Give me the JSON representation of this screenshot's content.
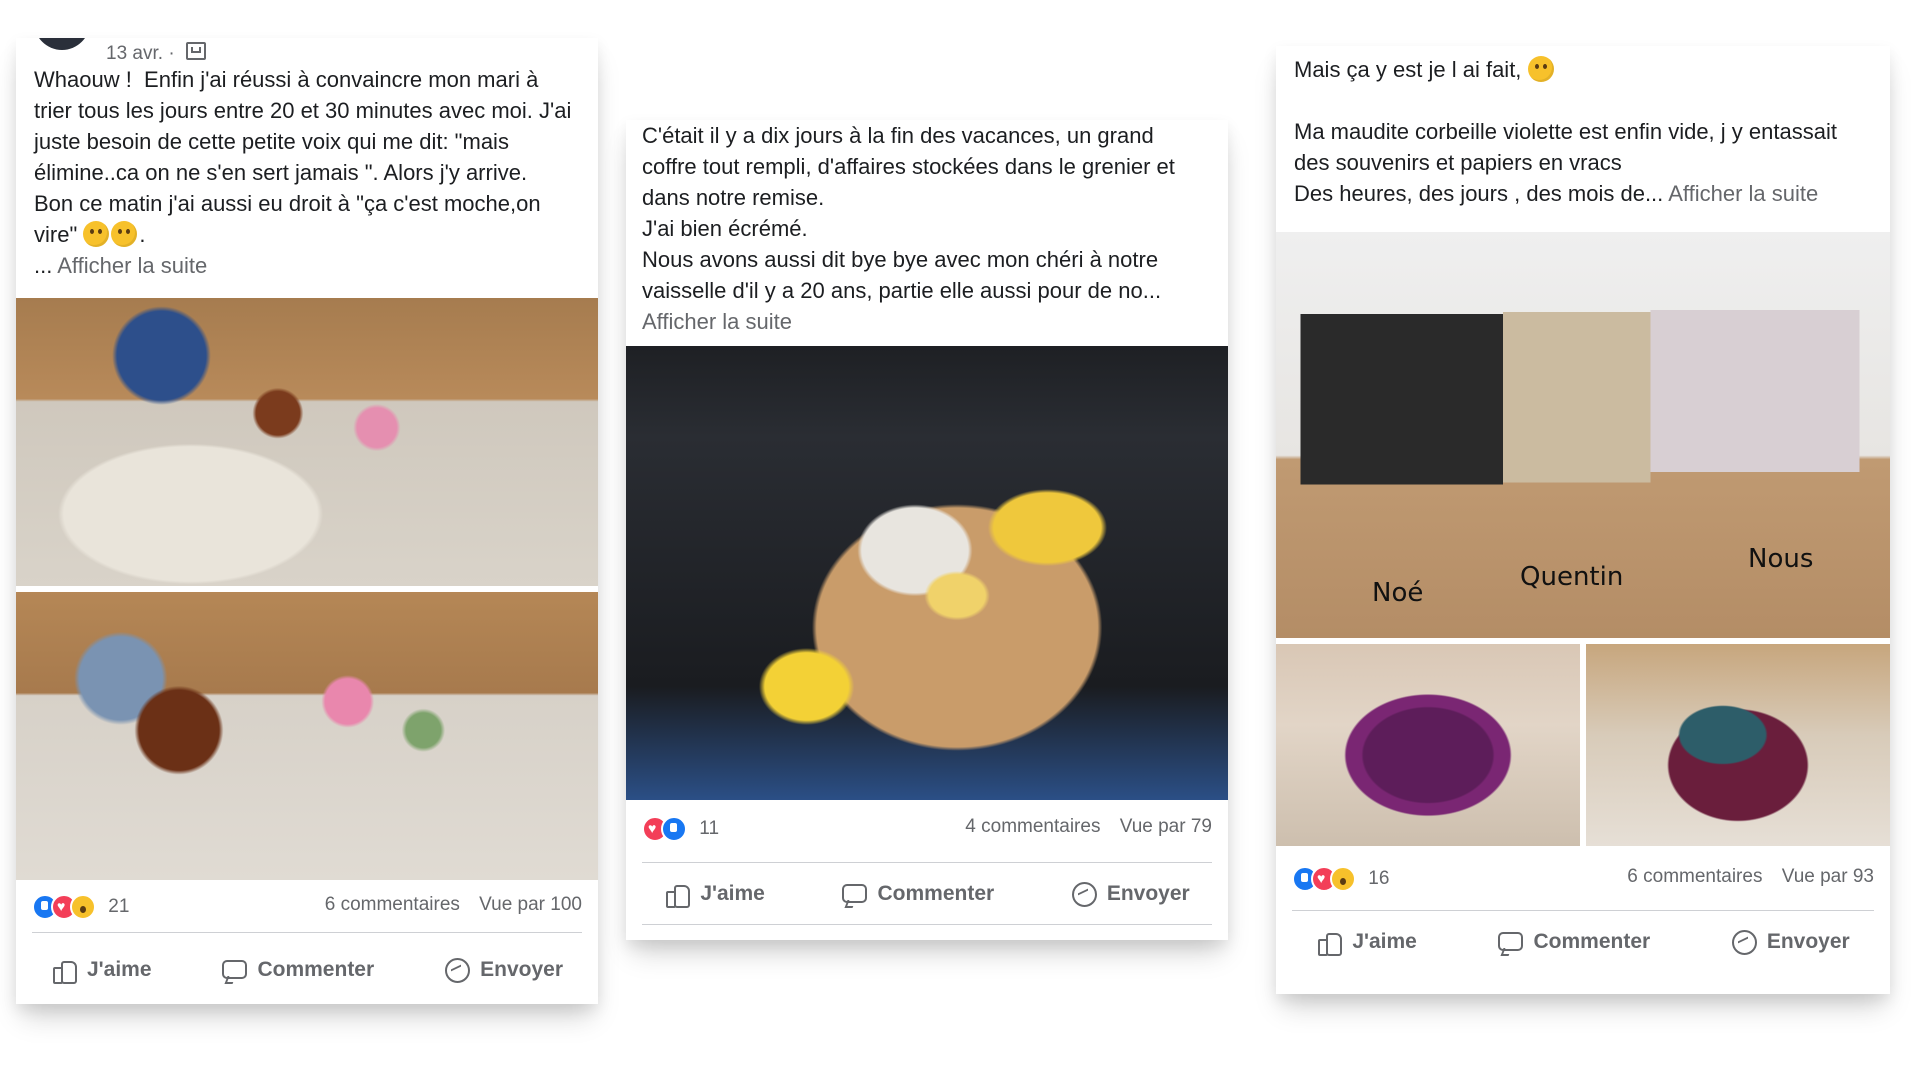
{
  "posts": [
    {
      "date": "13 avr. ·",
      "privacy_icon": "group-icon",
      "text": "Whaouw !  Enfin j'ai réussi à convaincre mon mari à trier tous les jours entre 20 et 30 minutes avec moi. J'ai juste besoin de cette petite voix qui me dit: \"mais élimine..ca on ne s'en sert jamais \". Alors j'y arrive.\nBon ce matin j'ai aussi eu droit à \"ça c'est moche,on vire\"",
      "text_tail": ".",
      "more_prefix": "... ",
      "more_label": "Afficher la suite",
      "reactions": [
        "like",
        "love",
        "wow"
      ],
      "reaction_count": "21",
      "comments": "6 commentaires",
      "views": "Vue par 100"
    },
    {
      "text": "C'était il y a dix jours à la fin des vacances, un grand coffre tout rempli, d'affaires stockées dans le grenier et dans notre remise.\nJ'ai bien écrémé.\nNous avons aussi dit bye bye avec mon chéri à notre vaisselle d'il y a 20 ans, partie elle aussi pour de no...",
      "more_label": "Afficher la suite",
      "reactions": [
        "love",
        "like"
      ],
      "reaction_count": "11",
      "comments": "4 commentaires",
      "views": "Vue par 79"
    },
    {
      "text": "Mais ça y est je l ai fait, ",
      "text2": "Ma maudite corbeille violette est enfin vide, j y entassait des souvenirs et papiers en vracs\nDes heures, des jours , des mois de...",
      "more_label": "Afficher la suite",
      "box_labels": [
        "Noé",
        "Quentin",
        "Nous"
      ],
      "reactions": [
        "like",
        "love",
        "wow"
      ],
      "reaction_count": "16",
      "comments": "6 commentaires",
      "views": "Vue par 93"
    }
  ],
  "actions": {
    "like": "J'aime",
    "comment": "Commenter",
    "send": "Envoyer"
  },
  "colors": {
    "meta_text": "#65676b",
    "like_blue": "#1877f2",
    "love_red": "#f33e58",
    "wow_yellow": "#f7c12b"
  }
}
